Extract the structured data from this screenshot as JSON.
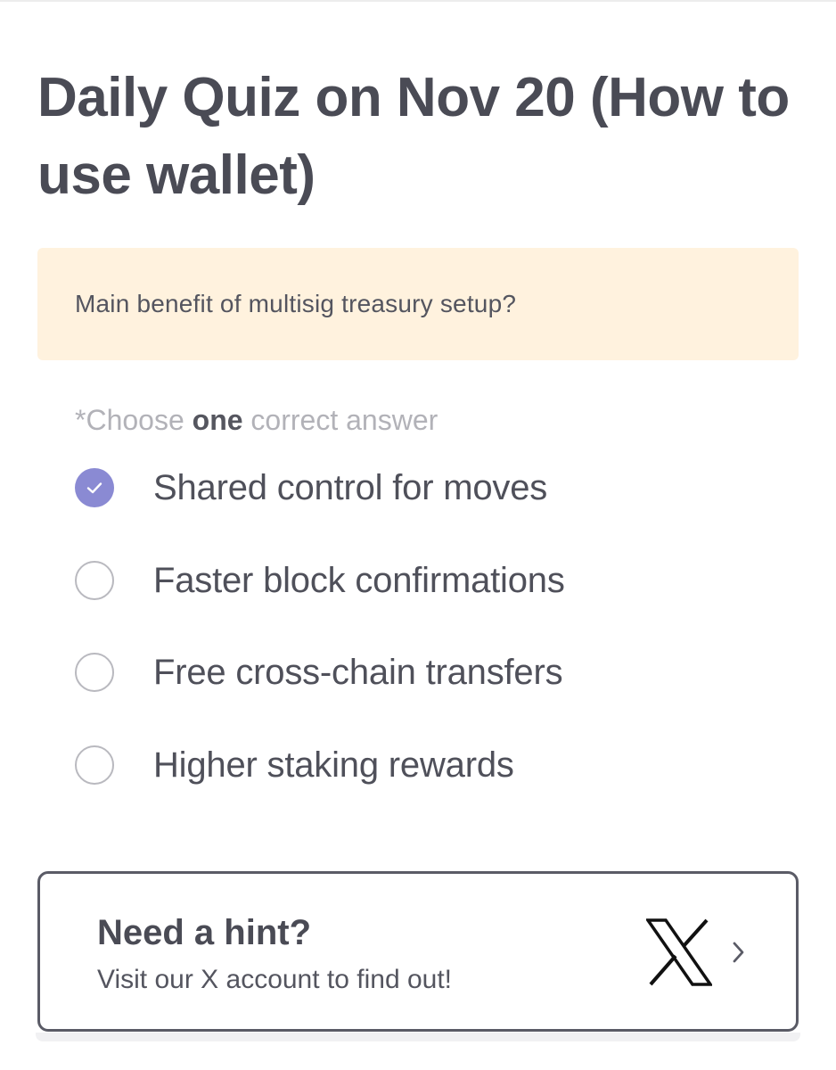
{
  "quiz": {
    "title": "Daily Quiz on Nov 20 (How to use wallet)",
    "question": "Main benefit of multisig treasury setup?",
    "instruction": {
      "prefix": "*Choose ",
      "emphasis": "one",
      "suffix": " correct answer"
    },
    "options": [
      {
        "label": "Shared control for moves",
        "selected": true
      },
      {
        "label": "Faster block confirmations",
        "selected": false
      },
      {
        "label": "Free cross-chain transfers",
        "selected": false
      },
      {
        "label": "Higher staking rewards",
        "selected": false
      }
    ]
  },
  "hint": {
    "title": "Need a hint?",
    "subtitle": "Visit our X account to find out!",
    "icon": "x-logo-icon",
    "arrow_icon": "chevron-right-icon"
  },
  "colors": {
    "accent": "#8a8ad3",
    "question_bg": "#fff2de",
    "text": "#4a4b55",
    "muted": "#b2b2b8"
  }
}
